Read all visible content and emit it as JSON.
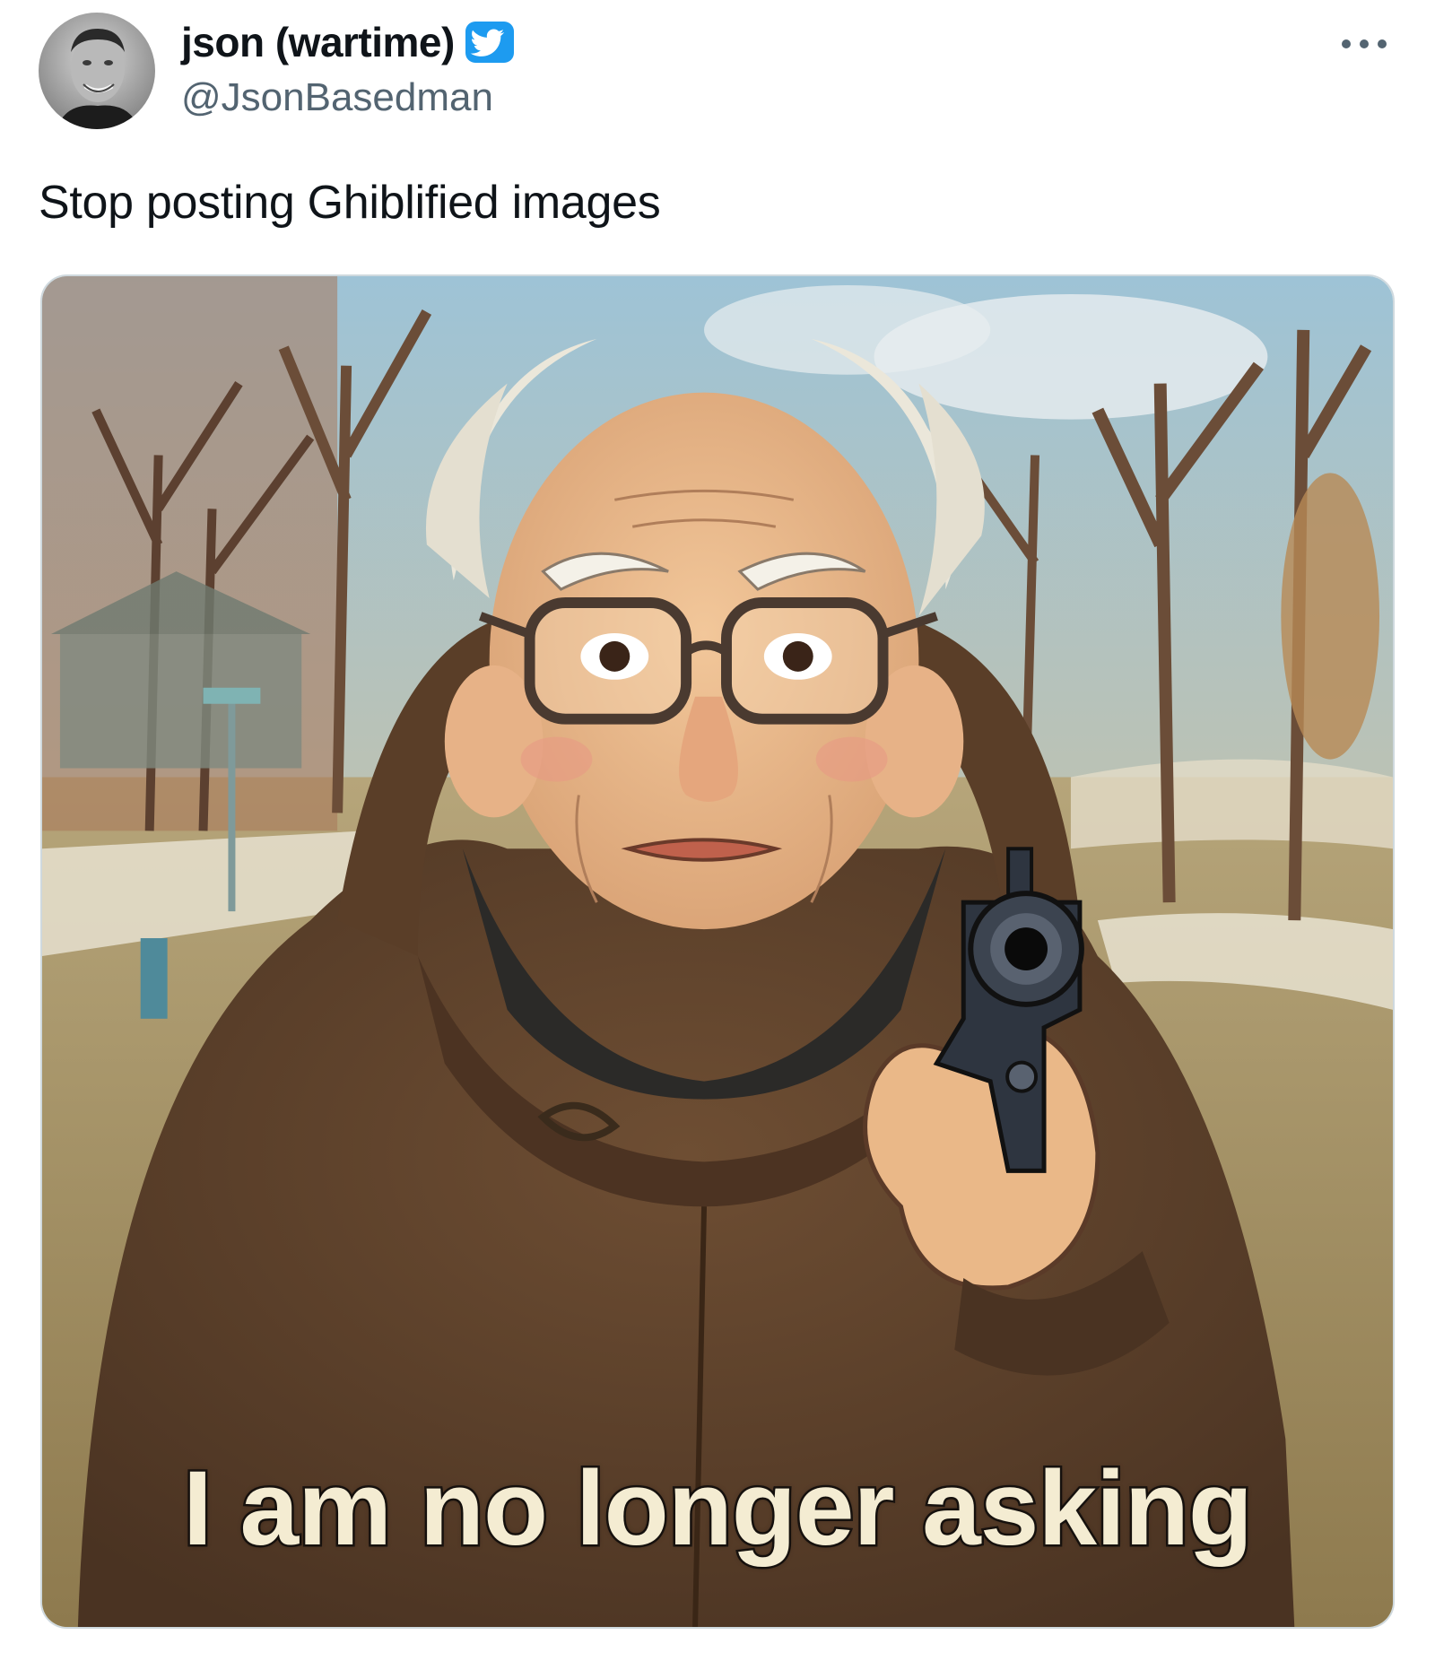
{
  "tweet": {
    "author": {
      "display_name": "json (wartime)",
      "handle": "@JsonBasedman",
      "verified": true,
      "avatar_icon": "profile-photo"
    },
    "more_icon": "more-dots-icon",
    "text": "Stop posting Ghiblified images",
    "media": {
      "caption": "I am no longer asking"
    }
  },
  "colors": {
    "text_primary": "#0f1419",
    "text_secondary": "#536471",
    "verified_blue": "#1d9bf0",
    "border": "#cfd9de"
  }
}
